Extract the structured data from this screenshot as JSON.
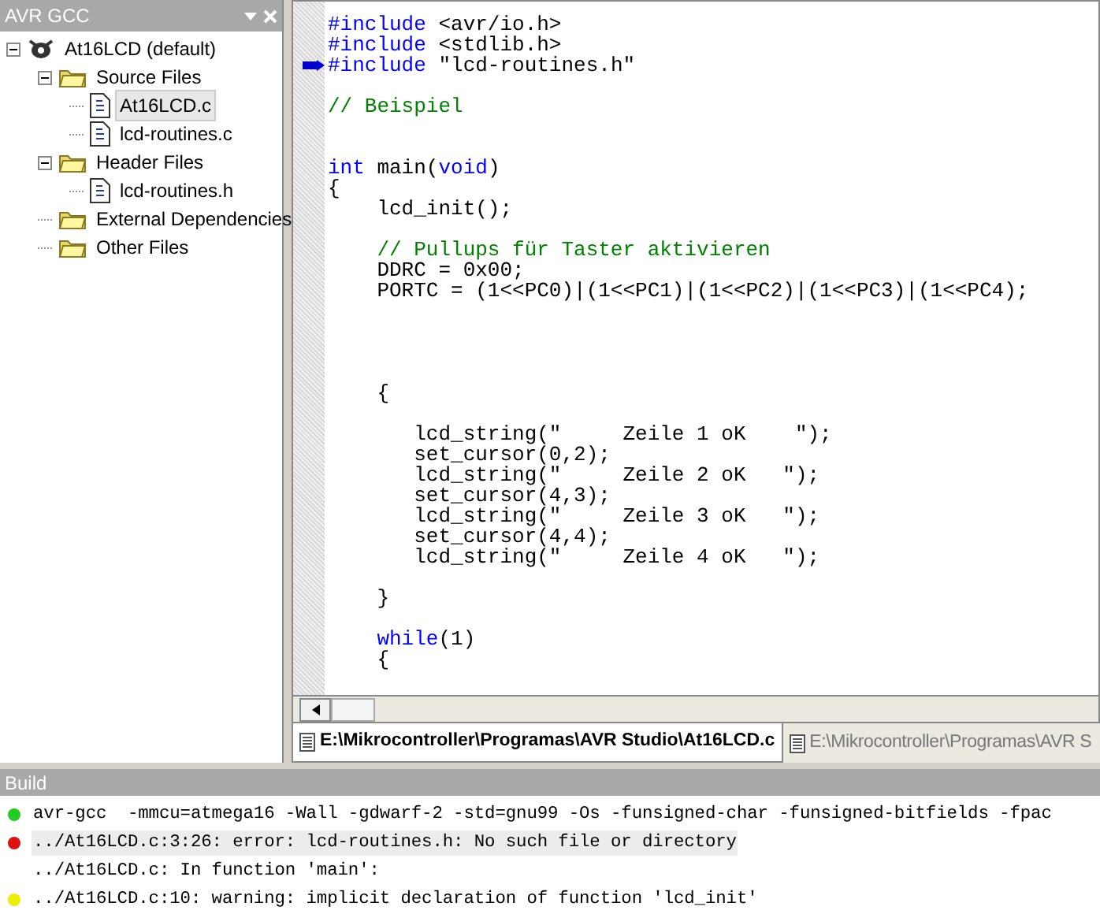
{
  "project_panel": {
    "title": "AVR GCC",
    "tree": [
      {
        "label": "At16LCD (default)",
        "kind": "project",
        "expanded": true,
        "selected": false,
        "children": [
          {
            "label": "Source Files",
            "kind": "folder",
            "expanded": true,
            "selected": false,
            "children": [
              {
                "label": "At16LCD.c",
                "kind": "file",
                "selected": true
              },
              {
                "label": "lcd-routines.c",
                "kind": "file",
                "selected": false
              }
            ]
          },
          {
            "label": "Header Files",
            "kind": "folder",
            "expanded": true,
            "selected": false,
            "children": [
              {
                "label": "lcd-routines.h",
                "kind": "file",
                "selected": false
              }
            ]
          },
          {
            "label": "External Dependencies",
            "kind": "folder",
            "selected": false
          },
          {
            "label": "Other Files",
            "kind": "folder",
            "selected": false
          }
        ]
      }
    ]
  },
  "editor": {
    "lines": [
      {
        "kind": "code",
        "tokens": [
          {
            "kind": "keyword",
            "text": "#include"
          },
          {
            "kind": "plain",
            "text": " <avr/io.h>"
          }
        ]
      },
      {
        "kind": "code",
        "tokens": [
          {
            "kind": "keyword",
            "text": "#include"
          },
          {
            "kind": "plain",
            "text": " <stdlib.h>"
          }
        ]
      },
      {
        "kind": "code",
        "marker": true,
        "tokens": [
          {
            "kind": "keyword",
            "text": "#include"
          },
          {
            "kind": "plain",
            "text": " \"lcd-routines.h\""
          }
        ]
      },
      {
        "kind": "blank"
      },
      {
        "kind": "code",
        "tokens": [
          {
            "kind": "comment",
            "text": "// Beispiel"
          }
        ]
      },
      {
        "kind": "blank"
      },
      {
        "kind": "blank"
      },
      {
        "kind": "code",
        "tokens": [
          {
            "kind": "keyword",
            "text": "int"
          },
          {
            "kind": "plain",
            "text": " main("
          },
          {
            "kind": "keyword",
            "text": "void"
          },
          {
            "kind": "plain",
            "text": ")"
          }
        ]
      },
      {
        "kind": "code",
        "tokens": [
          {
            "kind": "plain",
            "text": "{"
          }
        ]
      },
      {
        "kind": "code",
        "tokens": [
          {
            "kind": "plain",
            "text": "    lcd_init();"
          }
        ]
      },
      {
        "kind": "blank"
      },
      {
        "kind": "code",
        "tokens": [
          {
            "kind": "comment",
            "text": "    // Pullups für Taster aktivieren"
          }
        ]
      },
      {
        "kind": "code",
        "tokens": [
          {
            "kind": "plain",
            "text": "    DDRC = 0x00;"
          }
        ]
      },
      {
        "kind": "code",
        "tokens": [
          {
            "kind": "plain",
            "text": "    PORTC = (1<<PC0)|(1<<PC1)|(1<<PC2)|(1<<PC3)|(1<<PC4);"
          }
        ]
      },
      {
        "kind": "blank"
      },
      {
        "kind": "blank"
      },
      {
        "kind": "blank"
      },
      {
        "kind": "blank"
      },
      {
        "kind": "code",
        "tokens": [
          {
            "kind": "plain",
            "text": "    {"
          }
        ]
      },
      {
        "kind": "blank"
      },
      {
        "kind": "code",
        "tokens": [
          {
            "kind": "plain",
            "text": "       lcd_string(\"     Zeile 1 oK    \");"
          }
        ]
      },
      {
        "kind": "code",
        "tokens": [
          {
            "kind": "plain",
            "text": "       set_cursor(0,2);"
          }
        ]
      },
      {
        "kind": "code",
        "tokens": [
          {
            "kind": "plain",
            "text": "       lcd_string(\"     Zeile 2 oK   \");"
          }
        ]
      },
      {
        "kind": "code",
        "tokens": [
          {
            "kind": "plain",
            "text": "       set_cursor(4,3);"
          }
        ]
      },
      {
        "kind": "code",
        "tokens": [
          {
            "kind": "plain",
            "text": "       lcd_string(\"     Zeile 3 oK   \");"
          }
        ]
      },
      {
        "kind": "code",
        "tokens": [
          {
            "kind": "plain",
            "text": "       set_cursor(4,4);"
          }
        ]
      },
      {
        "kind": "code",
        "tokens": [
          {
            "kind": "plain",
            "text": "       lcd_string(\"     Zeile 4 oK   \");"
          }
        ]
      },
      {
        "kind": "blank"
      },
      {
        "kind": "code",
        "tokens": [
          {
            "kind": "plain",
            "text": "    }"
          }
        ]
      },
      {
        "kind": "blank"
      },
      {
        "kind": "code",
        "tokens": [
          {
            "kind": "keyword",
            "text": "    while"
          },
          {
            "kind": "plain",
            "text": "(1)"
          }
        ]
      },
      {
        "kind": "code",
        "tokens": [
          {
            "kind": "plain",
            "text": "    {"
          }
        ]
      }
    ],
    "tabs": [
      {
        "label": "E:\\Mikrocontroller\\Programas\\AVR Studio\\At16LCD.c",
        "selected": true
      },
      {
        "label": "E:\\Mikrocontroller\\Programas\\AVR S",
        "selected": false
      }
    ]
  },
  "build": {
    "title": "Build",
    "messages": [
      {
        "text": "avr-gcc  -mmcu=atmega16 -Wall -gdwarf-2 -std=gnu99 -Os -funsigned-char -funsigned-bitfields -fpac",
        "color": "#22cc22",
        "selected": false
      },
      {
        "text": "../At16LCD.c:3:26: error: lcd-routines.h: No such file or directory",
        "color": "#dd1111",
        "selected": true
      },
      {
        "text": "../At16LCD.c: In function 'main':",
        "selected": false
      },
      {
        "text": "../At16LCD.c:10: warning: implicit declaration of function 'lcd_init'",
        "color": "#eeee00",
        "selected": false
      }
    ]
  }
}
